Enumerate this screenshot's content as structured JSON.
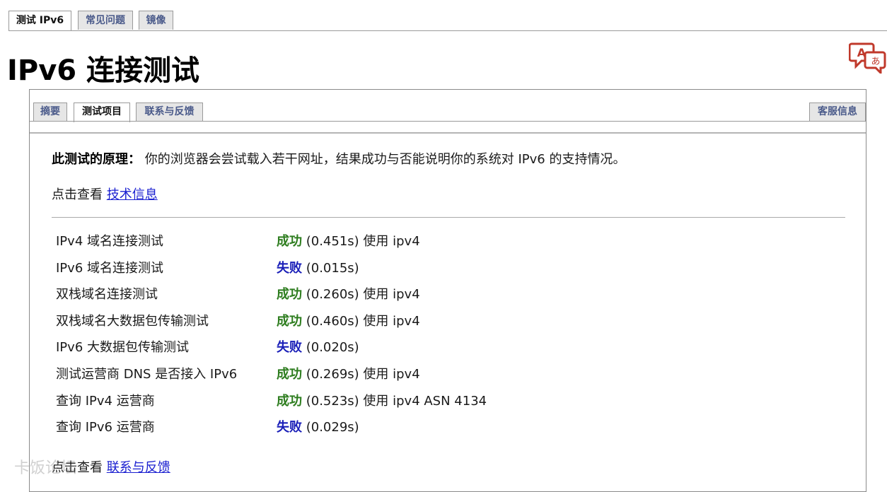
{
  "top_tabs": [
    {
      "label": "测试 IPv6",
      "active": true
    },
    {
      "label": "常见问题",
      "active": false
    },
    {
      "label": "镜像",
      "active": false
    }
  ],
  "page_title": "IPv6 连接测试",
  "sub_tabs": [
    {
      "label": "摘要",
      "active": false
    },
    {
      "label": "测试项目",
      "active": true
    },
    {
      "label": "联系与反馈",
      "active": false
    }
  ],
  "support_tab": "客服信息",
  "principle": {
    "heading": "此测试的原理：",
    "text": "你的浏览器会尝试载入若干网址，结果成功与否能说明你的系统对 IPv6 的支持情况。"
  },
  "tech_info": {
    "prefix": "点击查看 ",
    "link": "技术信息"
  },
  "tests": [
    {
      "label": "IPv4 域名连接测试",
      "status": "成功",
      "ok": true,
      "detail": " (0.451s) 使用 ipv4"
    },
    {
      "label": "IPv6 域名连接测试",
      "status": "失败",
      "ok": false,
      "detail": " (0.015s)"
    },
    {
      "label": "双栈域名连接测试",
      "status": "成功",
      "ok": true,
      "detail": " (0.260s) 使用 ipv4"
    },
    {
      "label": "双栈域名大数据包传输测试",
      "status": "成功",
      "ok": true,
      "detail": " (0.460s) 使用 ipv4"
    },
    {
      "label": "IPv6 大数据包传输测试",
      "status": "失败",
      "ok": false,
      "detail": " (0.020s)"
    },
    {
      "label": "测试运营商 DNS 是否接入 IPv6",
      "status": "成功",
      "ok": true,
      "detail": " (0.269s) 使用 ipv4"
    },
    {
      "label": "查询 IPv4 运营商",
      "status": "成功",
      "ok": true,
      "detail": " (0.523s) 使用 ipv4 ASN 4134"
    },
    {
      "label": "查询 IPv6 运营商",
      "status": "失败",
      "ok": false,
      "detail": " (0.029s)"
    }
  ],
  "feedback": {
    "prefix": "点击查看 ",
    "link": "联系与反馈"
  },
  "watermark": "卡饭论坛",
  "colors": {
    "success": "#2e7d1f",
    "fail": "#1a1fb8",
    "link": "#1a1fd0",
    "tab_text": "#4a5a8a"
  }
}
